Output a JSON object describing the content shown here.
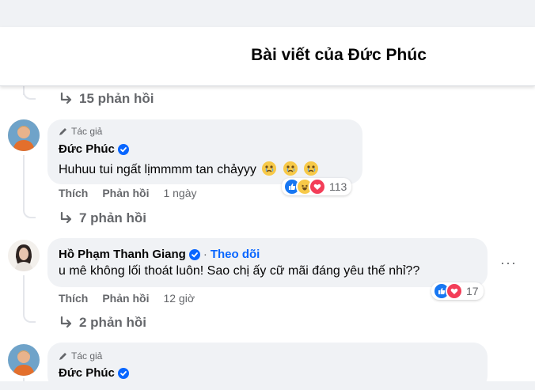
{
  "header": {
    "title": "Bài viết của Đức Phúc"
  },
  "top_replies": {
    "label": "15 phản hồi"
  },
  "comments": [
    {
      "author_badge": "Tác giả",
      "name": "Đức Phúc",
      "text": "Huhuu tui ngất lịmmmm tan chảyyy",
      "actions": {
        "like": "Thích",
        "reply": "Phản hồi",
        "time": "1 ngày"
      },
      "reactions": {
        "icons": [
          "like-icon",
          "haha-icon",
          "love-icon"
        ],
        "count": "113"
      },
      "replies": "7 phản hồi"
    },
    {
      "name": "Hồ Phạm Thanh Giang",
      "follow_separator": "·",
      "follow": "Theo dõi",
      "text": "u mê không lối thoát luôn! Sao chị ấy cữ mãi đáng yêu thế nhỉ??",
      "actions": {
        "like": "Thích",
        "reply": "Phản hồi",
        "time": "12 giờ"
      },
      "reactions": {
        "icons": [
          "like-icon",
          "love-icon"
        ],
        "count": "17"
      },
      "replies": "2 phản hồi",
      "more": "···"
    },
    {
      "author_badge": "Tác giả",
      "name": "Đức Phúc"
    }
  ],
  "colors": {
    "accent": "#0866ff",
    "muted": "#65676b",
    "bubble": "#f0f2f5"
  }
}
